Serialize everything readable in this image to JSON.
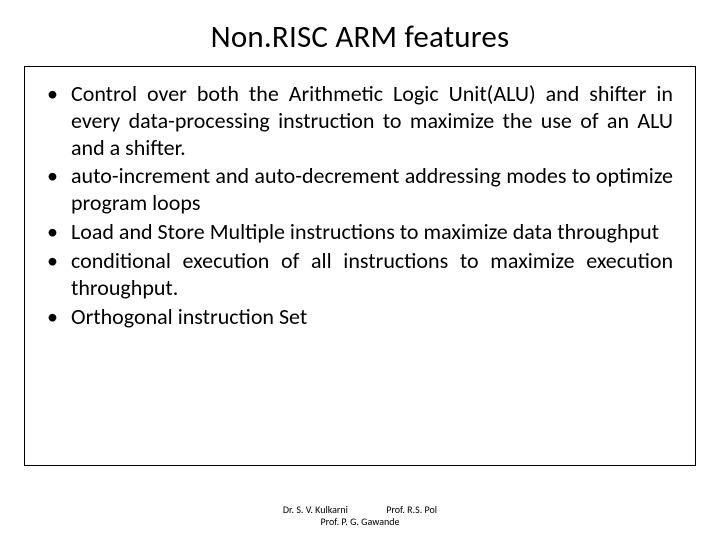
{
  "title": "Non.RISC ARM features",
  "bullets": [
    "Control over both the Arithmetic Logic Unit(ALU) and shifter in every data-processing instruction to maximize the use of an ALU and a shifter.",
    "auto-increment and auto-decrement addressing modes to optimize program loops",
    "Load and Store Multiple instructions to maximize data throughput",
    "conditional execution of all instructions to maximize execution throughput.",
    "Orthogonal instruction Set"
  ],
  "footer": {
    "name1": "Dr. S. V. Kulkarni",
    "name2": "Prof. R.S. Pol",
    "name3": "Prof. P. G. Gawande"
  }
}
